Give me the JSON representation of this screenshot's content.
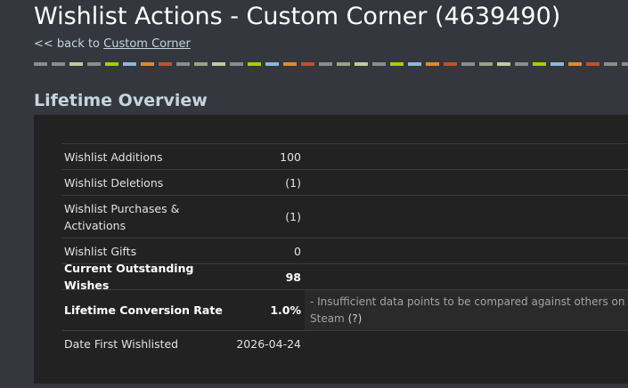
{
  "page": {
    "title": "Wishlist Actions - Custom Corner (4639490)",
    "back_prefix": "<< back to ",
    "back_link": "Custom Corner"
  },
  "stripe_colors": [
    "#8c8c8c",
    "#8c8c8c",
    "#c8c8a0",
    "#8c8c8c",
    "#a4d007",
    "#8fb7d4",
    "#e08a2c",
    "#c0502c",
    "#8c8c8c",
    "#a0a080",
    "#c8c8a0",
    "#8c8c8c",
    "#a4d007",
    "#8fb7d4",
    "#e08a2c",
    "#c0502c",
    "#8c8c8c",
    "#a0a080",
    "#c8c8a0",
    "#8c8c8c",
    "#a4d007",
    "#8fb7d4",
    "#e08a2c",
    "#c0502c",
    "#8c8c8c",
    "#a0a080",
    "#c8c8a0",
    "#8c8c8c",
    "#a4d007",
    "#8fb7d4",
    "#e08a2c",
    "#c0502c",
    "#8c8c8c",
    "#8c8c8c"
  ],
  "section": {
    "title": "Lifetime Overview"
  },
  "stats": [
    {
      "label": "Wishlist Additions",
      "value": "100",
      "bold": false
    },
    {
      "label": "Wishlist Deletions",
      "value": "(1)",
      "bold": false
    },
    {
      "label": "Wishlist Purchases & Activations",
      "value": "(1)",
      "bold": false
    },
    {
      "label": "Wishlist Gifts",
      "value": "0",
      "bold": false
    },
    {
      "label": "Current Outstanding Wishes",
      "value": "98",
      "bold": true
    },
    {
      "label": "Lifetime Conversion Rate",
      "value": "1.0%",
      "bold": true,
      "note": "- Insufficient data points to be compared against others on Steam",
      "help": "(?)"
    },
    {
      "label": "Date First Wishlisted",
      "value": "2026-04-24",
      "bold": false
    }
  ]
}
